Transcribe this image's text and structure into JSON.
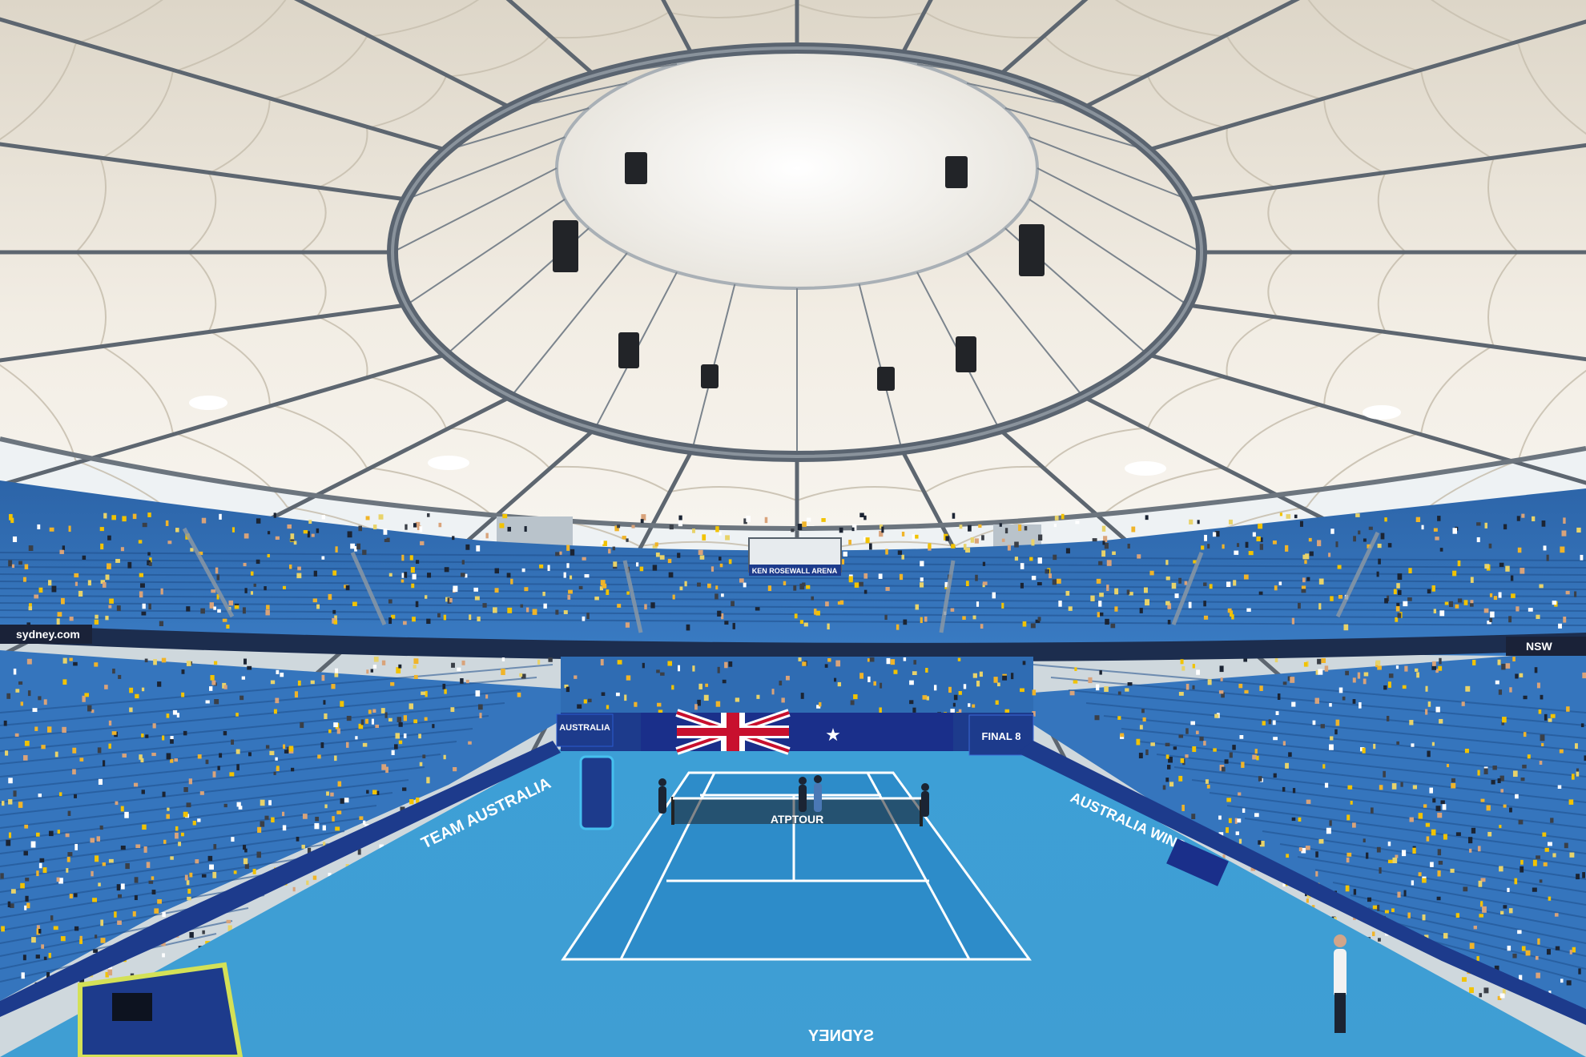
{
  "photo": {
    "subject": "",
    "colors": {
      "roof_fabric": "#f1ece2",
      "roof_steel": "#5d6670",
      "seat_blue": "#2f6fb5",
      "seat_dark": "#1f4f8c",
      "court_surface": "#3aa0d8",
      "playing_area": "#2d8cc9",
      "court_lines": "#ffffff",
      "signage_navy": "#1d3b8c",
      "flag_red": "#c8102e"
    }
  },
  "signage": {
    "sydney_com": "sydney.com",
    "arena_name": "KEN ROSEWALL ARENA",
    "team_australia_left": "TEAM AUSTRALIA",
    "australia_wins": "AUSTRALIA WINS",
    "australia_banner": "AUSTRALIA",
    "final_8": "FINAL 8",
    "net_brand": "ATPTOUR",
    "baseline_text": "SYDNEY",
    "nsw": "NSW"
  }
}
